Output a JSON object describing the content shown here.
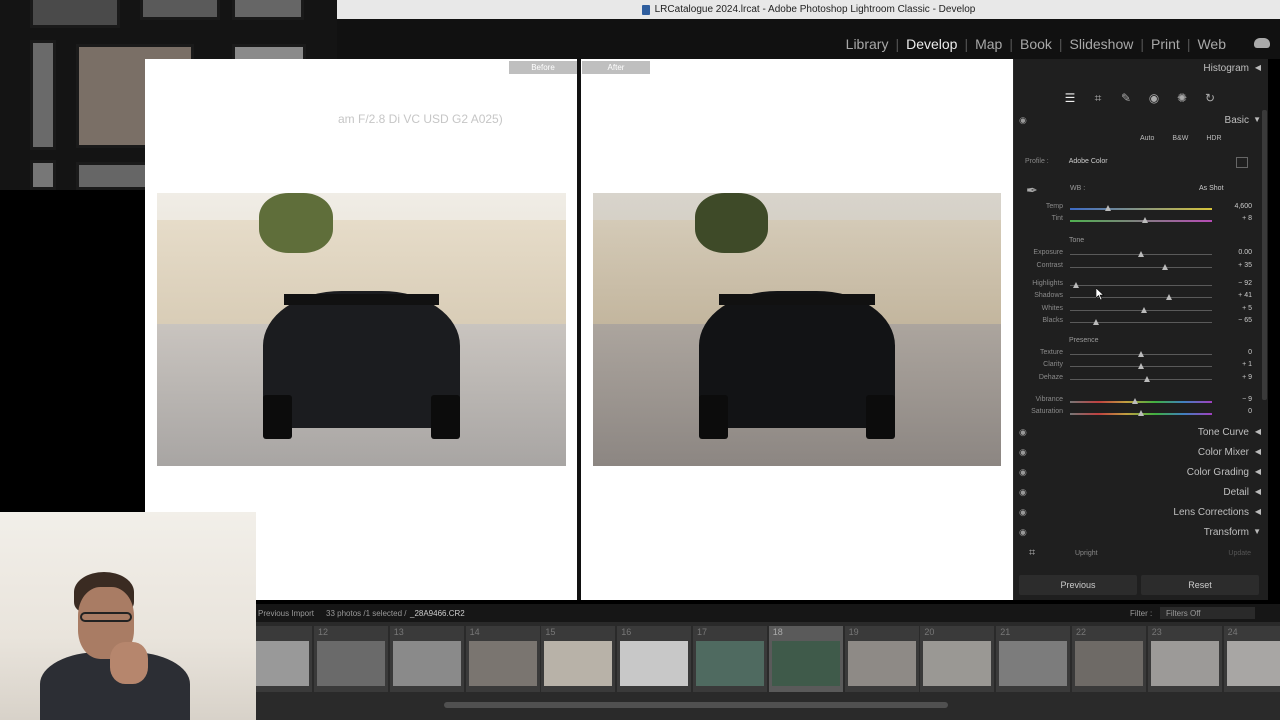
{
  "window": {
    "title": "LRCatalogue 2024.lrcat - Adobe Photoshop Lightroom Classic - Develop"
  },
  "modules": [
    {
      "label": "Library"
    },
    {
      "label": "Develop"
    },
    {
      "label": "Map"
    },
    {
      "label": "Book"
    },
    {
      "label": "Slideshow"
    },
    {
      "label": "Print"
    },
    {
      "label": "Web"
    }
  ],
  "compare": {
    "before_label": "Before",
    "after_label": "After",
    "lens_info": "am F/2.8 Di VC USD G2 A025)"
  },
  "panel": {
    "histogram": "Histogram",
    "basic": "Basic",
    "treatment": {
      "auto": "Auto",
      "bw": "B&W",
      "hdr": "HDR"
    },
    "profile_label": "Profile :",
    "profile_value": "Adobe Color",
    "wb_label": "WB :",
    "wb_value": "As Shot",
    "tone_label": "Tone",
    "presence_label": "Presence",
    "sliders": [
      {
        "label": "Temp",
        "value": "4,600",
        "pos": 0.27
      },
      {
        "label": "Tint",
        "value": "+ 8",
        "pos": 0.53
      },
      {
        "label": "Exposure",
        "value": "0.00",
        "pos": 0.5
      },
      {
        "label": "Contrast",
        "value": "+ 35",
        "pos": 0.67
      },
      {
        "label": "Highlights",
        "value": "− 92",
        "pos": 0.04
      },
      {
        "label": "Shadows",
        "value": "+ 41",
        "pos": 0.7
      },
      {
        "label": "Whites",
        "value": "+ 5",
        "pos": 0.52
      },
      {
        "label": "Blacks",
        "value": "− 65",
        "pos": 0.18
      },
      {
        "label": "Texture",
        "value": "0",
        "pos": 0.5
      },
      {
        "label": "Clarity",
        "value": "+ 1",
        "pos": 0.5
      },
      {
        "label": "Dehaze",
        "value": "+ 9",
        "pos": 0.54
      },
      {
        "label": "Vibrance",
        "value": "− 9",
        "pos": 0.46
      },
      {
        "label": "Saturation",
        "value": "0",
        "pos": 0.5
      }
    ],
    "sections": [
      {
        "label": "Tone Curve"
      },
      {
        "label": "Color Mixer"
      },
      {
        "label": "Color Grading"
      },
      {
        "label": "Detail"
      },
      {
        "label": "Lens Corrections"
      },
      {
        "label": "Transform"
      }
    ],
    "upright": "Upright",
    "update": "Update",
    "previous": "Previous",
    "reset": "Reset"
  },
  "filmstrip": {
    "source": "Previous Import",
    "info": "33 photos /1 selected /",
    "filename": "_28A9466.CR2",
    "filter_label": "Filter :",
    "filter_value": "Filters Off",
    "frames": [
      "12",
      "13",
      "14",
      "15",
      "16",
      "17",
      "18",
      "19",
      "20",
      "21",
      "22",
      "23",
      "24"
    ],
    "selected": "18"
  }
}
